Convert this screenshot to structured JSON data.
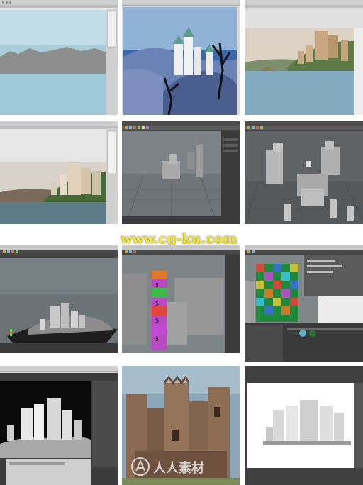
{
  "gallery": {
    "tiles": [
      {
        "name": "tile-water-horizon",
        "description_key": "ocean-horizon-sketch"
      },
      {
        "name": "tile-castle-painted-sketch"
      },
      {
        "name": "tile-castle-photo-island"
      },
      {
        "name": "tile-castle-on-cliff"
      },
      {
        "name": "tile-maya-blockout-simple"
      },
      {
        "name": "tile-maya-blockout-towers"
      },
      {
        "name": "tile-maya-castle-terrain"
      },
      {
        "name": "tile-maya-uv-checker-tower"
      },
      {
        "name": "tile-maya-uv-checker-wall"
      },
      {
        "name": "tile-render-occlusion"
      },
      {
        "name": "tile-textured-castle"
      },
      {
        "name": "tile-white-castle-render"
      }
    ]
  },
  "watermark": {
    "url_text": "www.cg-ku.com",
    "logo_text": "人人素材"
  },
  "uv_labels": [
    "5",
    "5",
    "5",
    "5"
  ],
  "colors": {
    "watermark_yellow": "#f6ea2a",
    "maya_dark": "#3a3a3a",
    "sky_blue": "#a9c9d6",
    "water_blue": "#9cc7d6",
    "mountain_gray": "#8e8e8e"
  }
}
